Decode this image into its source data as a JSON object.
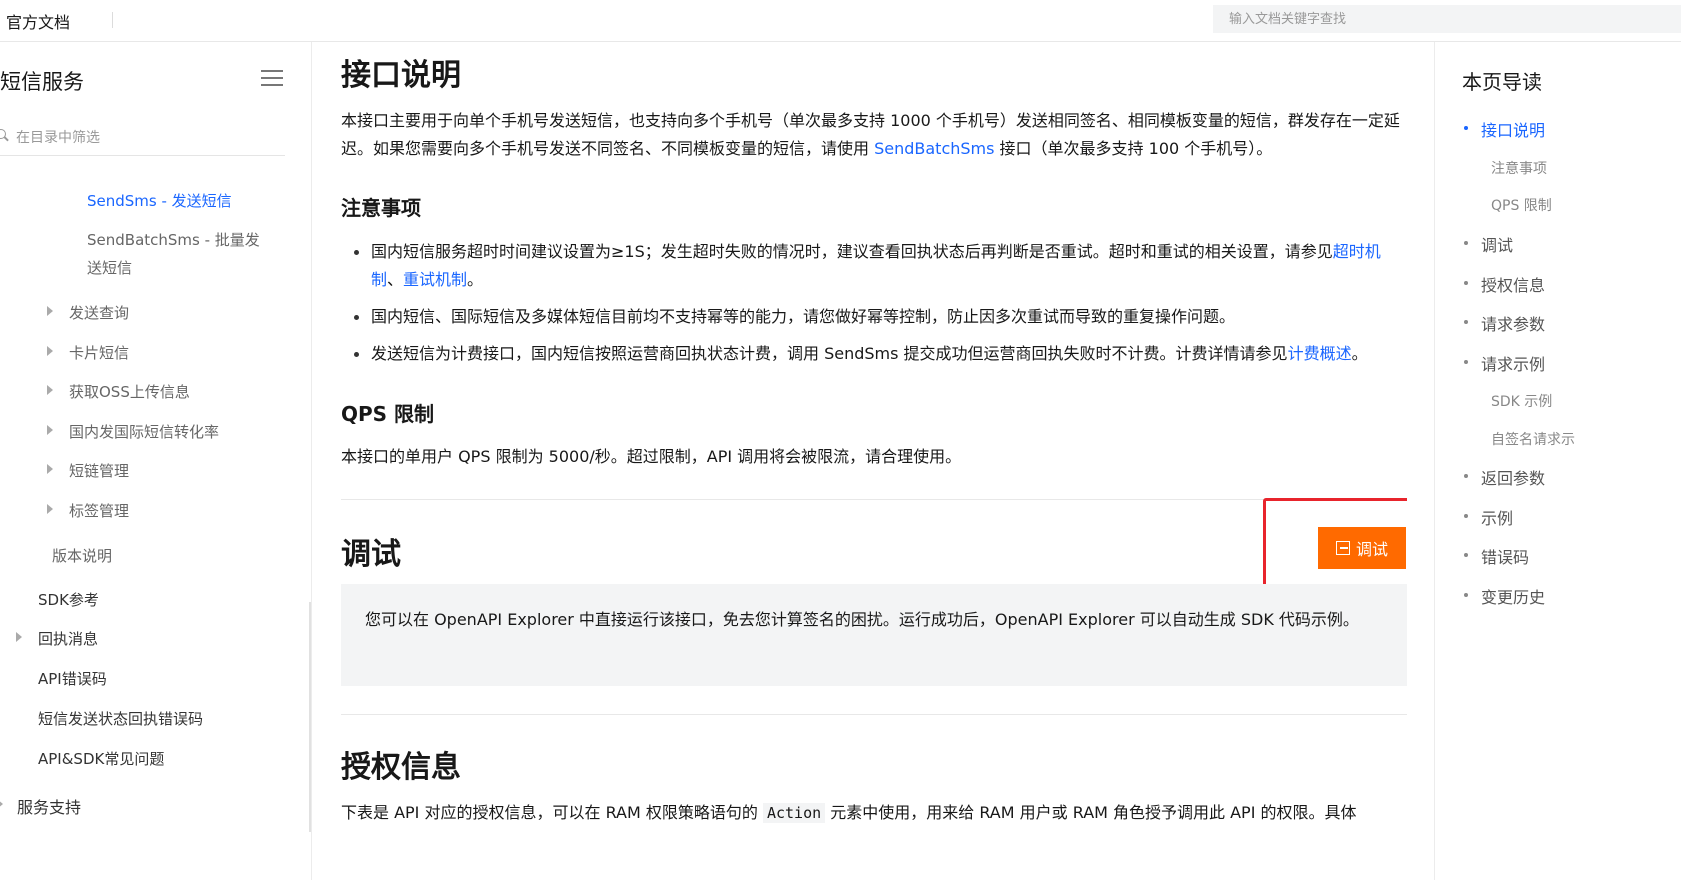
{
  "header": {
    "brand": "官方文档",
    "search_placeholder": "输入文档关键字查找"
  },
  "sidebar": {
    "title": "短信服务",
    "filter_placeholder": "在目录中筛选",
    "items": [
      {
        "label": "SendSms - 发送短信",
        "state": "active"
      },
      {
        "label": "SendBatchSms - 批量发送短信"
      },
      {
        "label": "发送查询"
      },
      {
        "label": "卡片短信"
      },
      {
        "label": "获取OSS上传信息"
      },
      {
        "label": "国内发国际短信转化率"
      },
      {
        "label": "短链管理"
      },
      {
        "label": "标签管理"
      },
      {
        "label": "版本说明"
      },
      {
        "label": "SDK参考"
      },
      {
        "label": "回执消息"
      },
      {
        "label": "API错误码"
      },
      {
        "label": "短信发送状态回执错误码"
      },
      {
        "label": "API&SDK常见问题"
      },
      {
        "label": "服务支持"
      }
    ]
  },
  "content": {
    "section1_title": "接口说明",
    "intro_text_1": "本接口主要用于向单个手机号发送短信，也支持向多个手机号（单次最多支持 1000 个手机号）发送相同签名、相同模板变量的短信，群发存在一定延迟。如果您需要向多个手机号发送不同签名、不同模板变量的短信，请使用 ",
    "intro_link": "SendBatchSms",
    "intro_text_2": " 接口（单次最多支持 100 个手机号）。",
    "notes_title": "注意事项",
    "bullet1_text": "国内短信服务超时时间建议设置为≥1S；发生超时失败的情况时，建议查看回执状态后再判断是否重试。超时和重试的相关设置，请参见",
    "bullet1_link1": "超时机制",
    "bullet1_sep": "、",
    "bullet1_link2": "重试机制",
    "bullet1_end": "。",
    "bullet2_text": "国内短信、国际短信及多媒体短信目前均不支持幂等的能力，请您做好幂等控制，防止因多次重试而导致的重复操作问题。",
    "bullet3_text": "发送短信为计费接口，国内短信按照运营商回执状态计费，调用 SendSms 提交成功但运营商回执失败时不计费。计费详情请参见",
    "bullet3_link": "计费概述",
    "bullet3_end": "。",
    "qps_title": "QPS 限制",
    "qps_text": "本接口的单用户 QPS 限制为 5000/秒。超过限制，API 调用将会被限流，请合理使用。",
    "debug_title": "调试",
    "debug_button": "调试",
    "debug_note": "您可以在 OpenAPI Explorer 中直接运行该接口，免去您计算签名的困扰。运行成功后，OpenAPI Explorer 可以自动生成 SDK 代码示例。",
    "auth_title": "授权信息",
    "auth_text_1": "下表是 API 对应的授权信息，可以在 RAM 权限策略语句的 ",
    "auth_code": "Action",
    "auth_text_2": " 元素中使用，用来给 RAM 用户或 RAM 角色授予调用此 API 的权限。具体"
  },
  "toc": {
    "title": "本页导读",
    "items": [
      {
        "label": "接口说明",
        "level": 1,
        "state": "active"
      },
      {
        "label": "注意事项",
        "level": 2
      },
      {
        "label": "QPS 限制",
        "level": 2
      },
      {
        "label": "调试",
        "level": 1
      },
      {
        "label": "授权信息",
        "level": 1
      },
      {
        "label": "请求参数",
        "level": 1
      },
      {
        "label": "请求示例",
        "level": 1
      },
      {
        "label": "SDK 示例",
        "level": 2
      },
      {
        "label": "自签名请求示",
        "level": 2
      },
      {
        "label": "返回参数",
        "level": 1
      },
      {
        "label": "示例",
        "level": 1
      },
      {
        "label": "错误码",
        "level": 1
      },
      {
        "label": "变更历史",
        "level": 1
      }
    ]
  },
  "colors": {
    "accent": "#1a66ff",
    "debug_button": "#ff6a00",
    "highlight_box": "#e8242c"
  }
}
